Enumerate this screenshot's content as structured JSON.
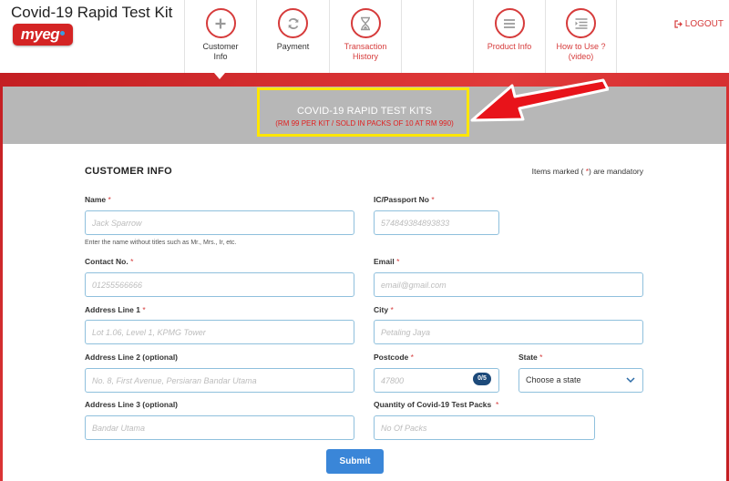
{
  "app": {
    "title": "Covid-19 Rapid Test Kit",
    "logo_text": "myeg"
  },
  "nav": {
    "items": [
      {
        "label_line1": "Customer",
        "label_line2": "Info",
        "icon": "plus-icon",
        "active": true
      },
      {
        "label_line1": "Payment",
        "label_line2": "",
        "icon": "refresh-icon"
      },
      {
        "label_line1": "Transaction",
        "label_line2": "History",
        "icon": "hourglass-icon"
      },
      {
        "label_line1": "Product Info",
        "label_line2": "",
        "icon": "list-icon"
      },
      {
        "label_line1": "How to Use ?",
        "label_line2": "(video)",
        "icon": "video-list-icon"
      }
    ],
    "logout_label": "LOGOUT"
  },
  "banner": {
    "title": "COVID-19 RAPID TEST KITS",
    "price": "(RM 99 PER KIT / SOLD IN PACKS OF 10 AT RM 990)"
  },
  "colors": {
    "brand_red": "#d63b3b",
    "highlight": "#ffe600",
    "submit_blue": "#3a86d8"
  },
  "form": {
    "section_title": "CUSTOMER INFO",
    "mandatory_note": "Items marked ( ) are mandatory",
    "mandatory_star": "*",
    "name": {
      "label": "Name",
      "placeholder": "Jack Sparrow",
      "help": "Enter the name without titles such as Mr., Mrs., Ir, etc."
    },
    "ic": {
      "label": "IC/Passport No",
      "placeholder": "574849384893833"
    },
    "contact": {
      "label": "Contact No.",
      "placeholder": "01255566666"
    },
    "email": {
      "label": "Email",
      "placeholder": "email@gmail.com"
    },
    "address1": {
      "label": "Address Line 1",
      "placeholder": "Lot 1.06, Level 1, KPMG Tower"
    },
    "city": {
      "label": "City",
      "placeholder": "Petaling Jaya"
    },
    "address2": {
      "label": "Address Line 2 (optional)",
      "placeholder": "No. 8, First Avenue, Persiaran Bandar Utama"
    },
    "postcode": {
      "label": "Postcode",
      "placeholder": "47800",
      "counter": "0/5"
    },
    "state": {
      "label": "State",
      "value": "Choose a state"
    },
    "address3": {
      "label": "Address Line 3 (optional)",
      "placeholder": "Bandar Utama"
    },
    "quantity": {
      "label": "Quantity of Covid-19 Test Packs",
      "placeholder": "No Of Packs"
    },
    "submit_label": "Submit"
  }
}
